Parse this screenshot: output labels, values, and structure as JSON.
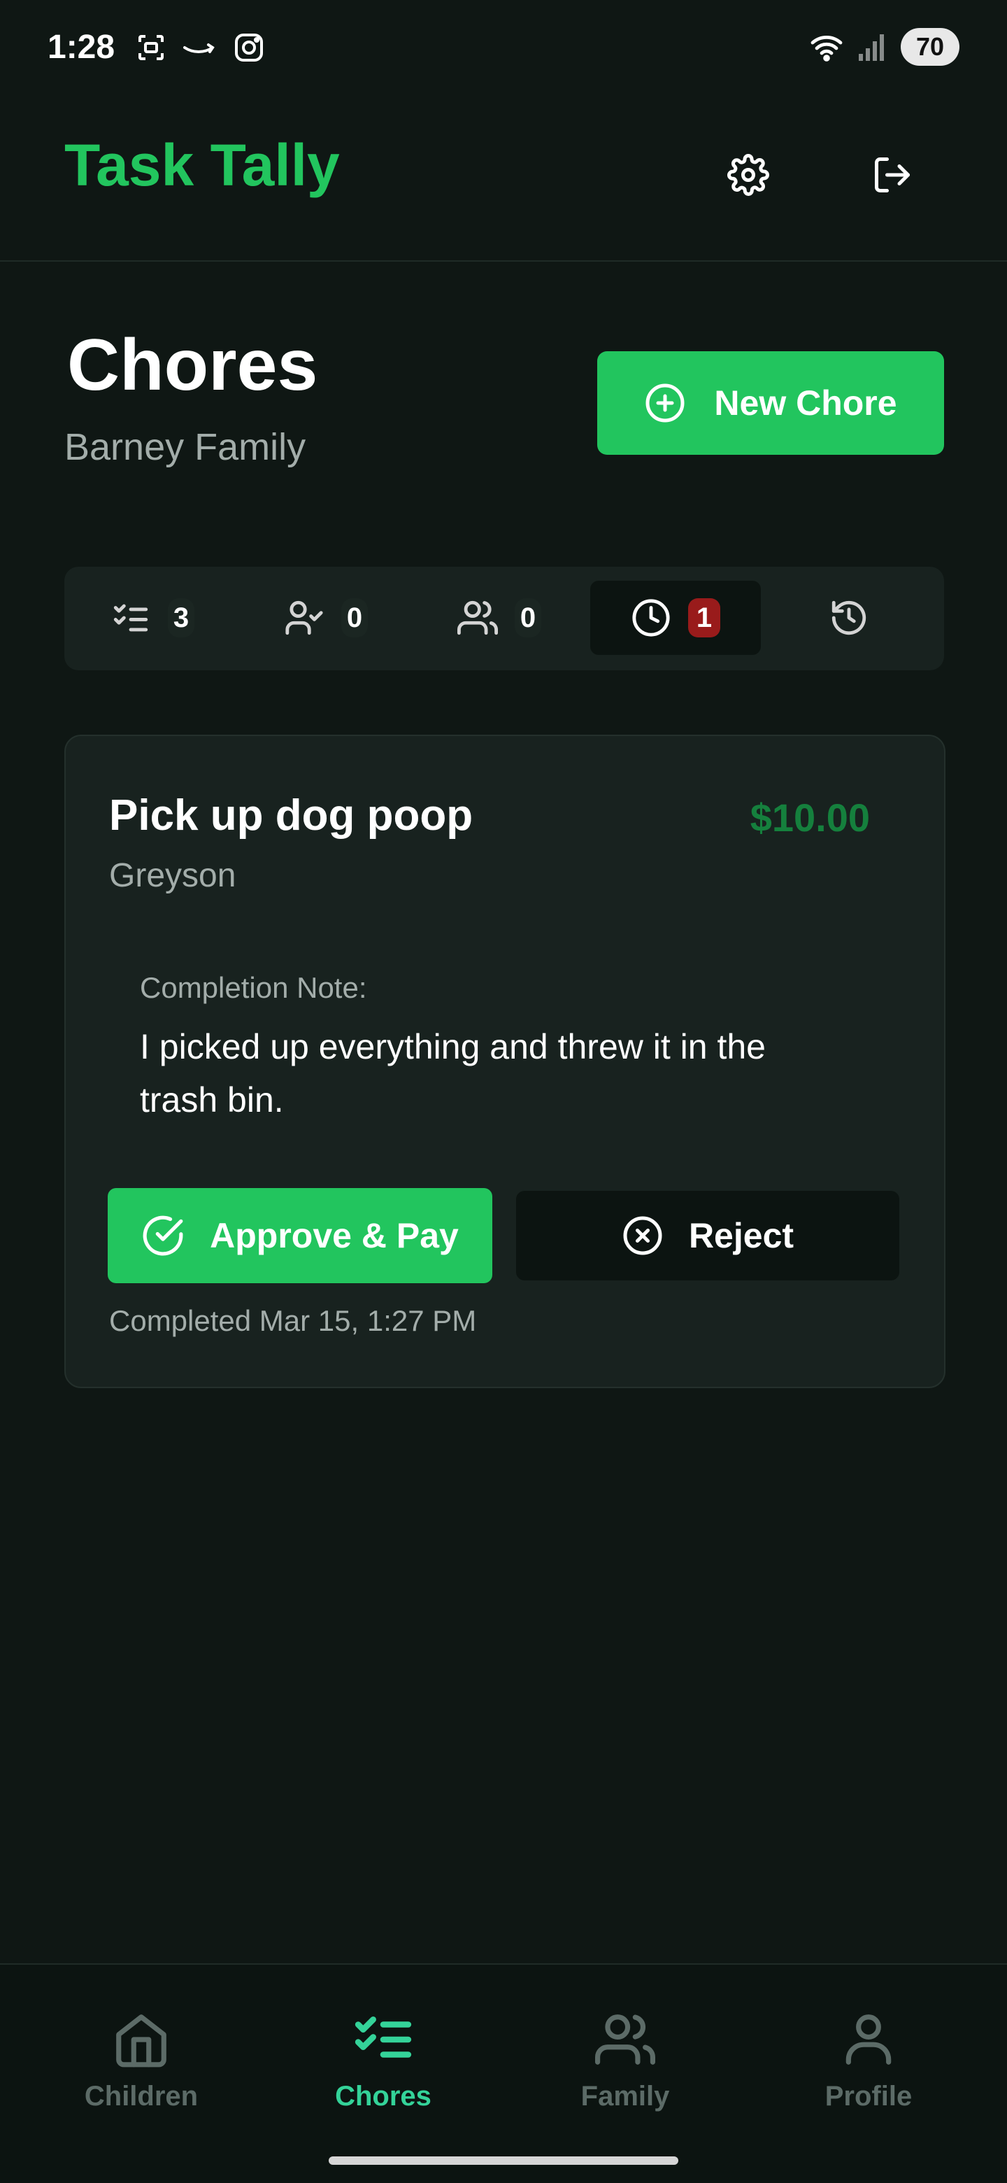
{
  "status_bar": {
    "time": "1:28",
    "battery": "70"
  },
  "app": {
    "title": "Task Tally"
  },
  "page": {
    "title": "Chores",
    "subtitle": "Barney Family",
    "new_chore_label": "New Chore"
  },
  "filters": [
    {
      "icon": "checklist-icon",
      "count": "3"
    },
    {
      "icon": "user-check-icon",
      "count": "0"
    },
    {
      "icon": "users-icon",
      "count": "0"
    },
    {
      "icon": "clock-icon",
      "count": "1",
      "active": true
    },
    {
      "icon": "history-icon",
      "count": ""
    }
  ],
  "chore": {
    "name": "Pick up dog poop",
    "amount": "$10.00",
    "child": "Greyson",
    "note_label": "Completion Note:",
    "note_text": "I picked up everything and threw it in the trash bin.",
    "approve_label": "Approve & Pay",
    "reject_label": "Reject",
    "completed": "Completed Mar 15, 1:27 PM"
  },
  "nav": [
    {
      "label": "Children",
      "icon": "home-icon"
    },
    {
      "label": "Chores",
      "icon": "checklist-icon",
      "active": true
    },
    {
      "label": "Family",
      "icon": "users-icon"
    },
    {
      "label": "Profile",
      "icon": "user-icon"
    }
  ],
  "colors": {
    "brand": "#22c55e",
    "background": "#0f1714",
    "card": "#18221f",
    "amount": "#15803d",
    "alert": "#991b1b",
    "nav_active": "#34d399"
  }
}
